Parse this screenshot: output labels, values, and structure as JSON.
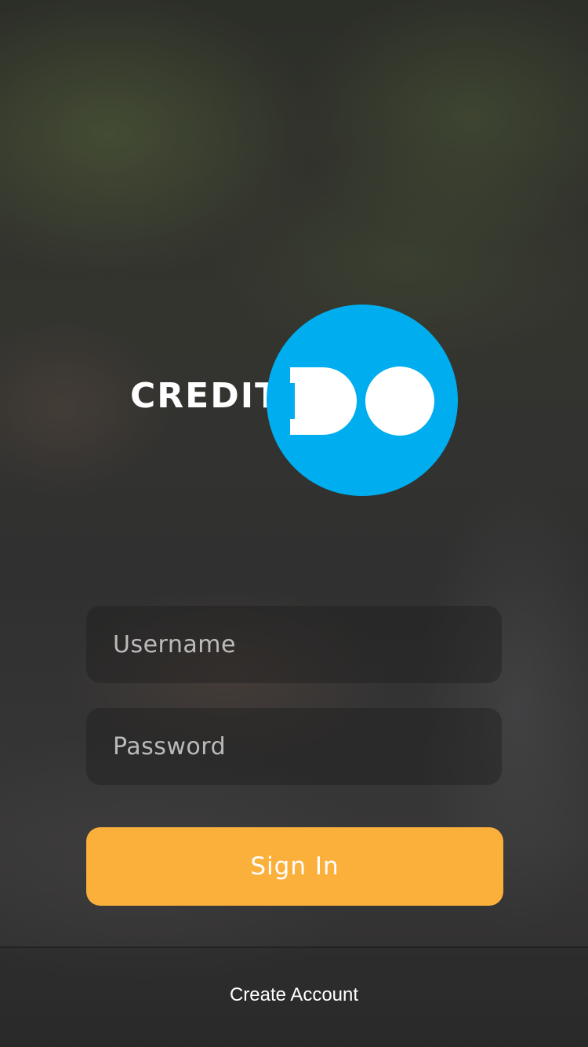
{
  "logo": {
    "wordmark": "CREDIT",
    "mark_text": "DO",
    "mark_color": "#00aeef"
  },
  "form": {
    "username": {
      "placeholder": "Username",
      "value": ""
    },
    "password": {
      "placeholder": "Password",
      "value": ""
    },
    "signin_label": "Sign In"
  },
  "footer": {
    "create_account_label": "Create Account"
  },
  "colors": {
    "accent": "#fbb03b",
    "brand_blue": "#00aeef",
    "text": "#ffffff"
  }
}
